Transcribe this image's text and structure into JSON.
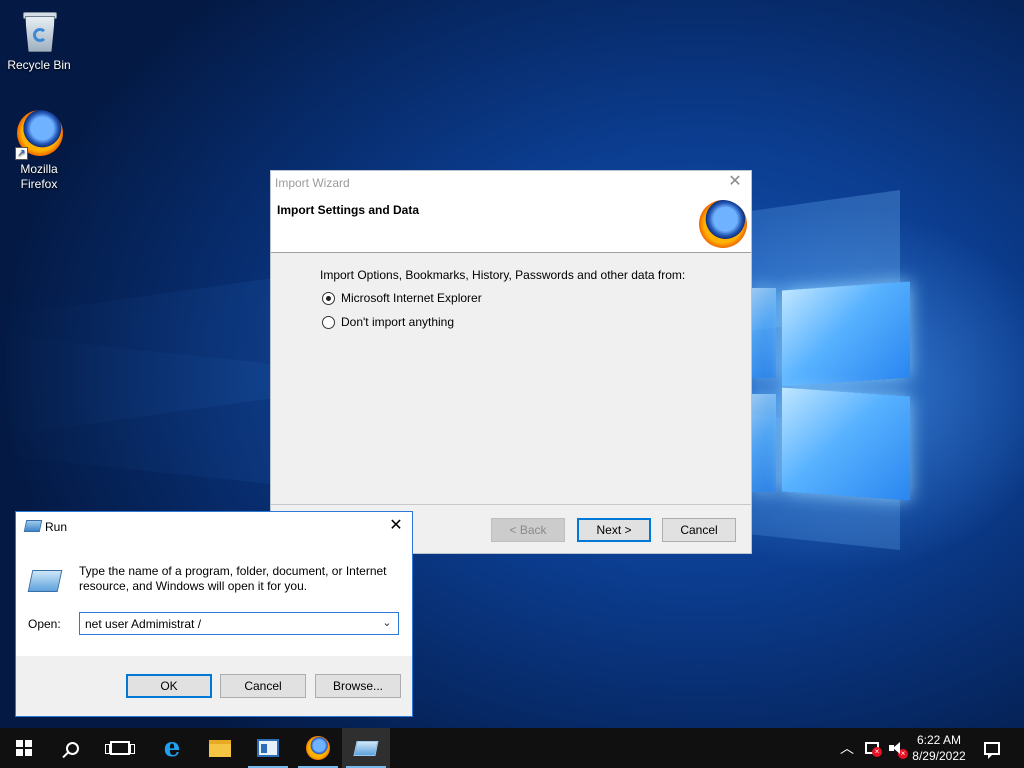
{
  "desktop": {
    "icons": [
      {
        "label": "Recycle Bin",
        "icon": "recycle-bin-icon"
      },
      {
        "label": "Mozilla Firefox",
        "icon": "firefox-icon"
      }
    ]
  },
  "import_wizard": {
    "title": "Import Wizard",
    "heading": "Import Settings and Data",
    "prompt": "Import Options, Bookmarks, History, Passwords and other data from:",
    "options": [
      {
        "label": "Microsoft Internet Explorer",
        "selected": true
      },
      {
        "label": "Don't import anything",
        "selected": false
      }
    ],
    "buttons": {
      "back": "< Back",
      "next": "Next >",
      "cancel": "Cancel"
    }
  },
  "run_dialog": {
    "title": "Run",
    "description": "Type the name of a program, folder, document, or Internet resource, and Windows will open it for you.",
    "open_label": "Open:",
    "open_value": "net user Admimistrat /",
    "buttons": {
      "ok": "OK",
      "cancel": "Cancel",
      "browse": "Browse..."
    }
  },
  "taskbar": {
    "pinned": [
      {
        "name": "start",
        "icon": "windows-logo-icon"
      },
      {
        "name": "search",
        "icon": "search-icon"
      },
      {
        "name": "task-view",
        "icon": "task-view-icon"
      },
      {
        "name": "internet-explorer",
        "icon": "internet-explorer-icon"
      },
      {
        "name": "file-explorer",
        "icon": "folder-icon"
      },
      {
        "name": "server-manager",
        "icon": "server-manager-icon",
        "running": true
      },
      {
        "name": "firefox",
        "icon": "firefox-icon",
        "running": true
      },
      {
        "name": "run",
        "icon": "run-icon",
        "running": true,
        "active": true
      }
    ],
    "tray": {
      "time": "6:22 AM",
      "date": "8/29/2022"
    }
  },
  "colors": {
    "accent": "#0078d7",
    "taskbar": "#101010",
    "desktop": "#0b3c8e"
  }
}
